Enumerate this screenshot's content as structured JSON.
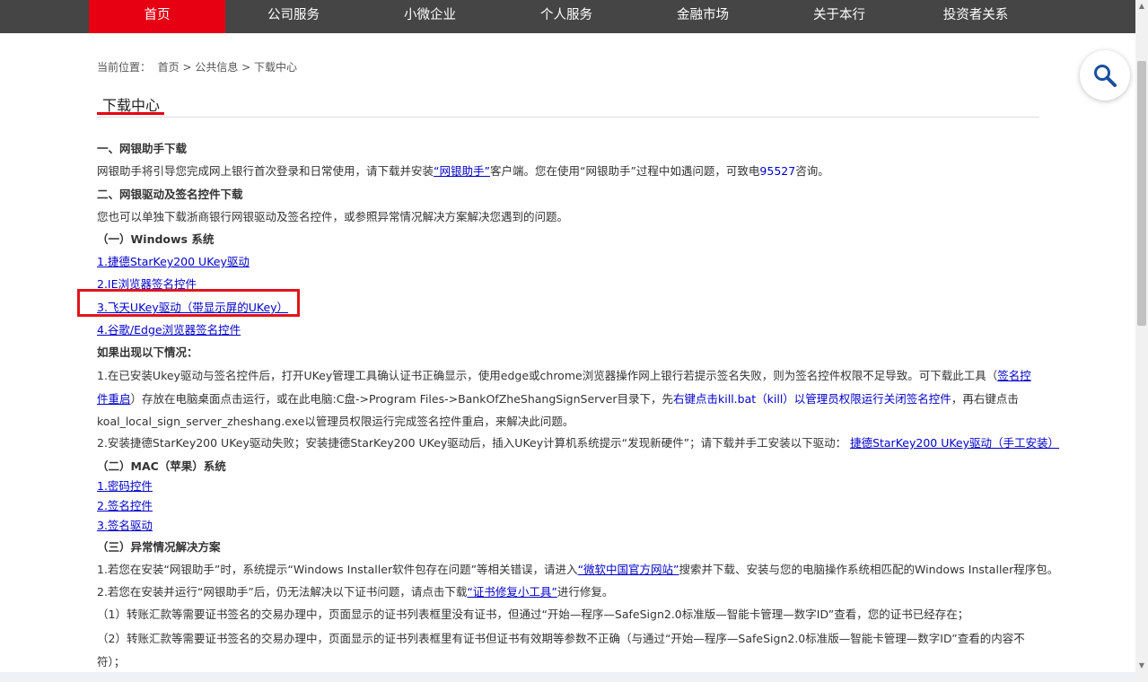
{
  "nav": {
    "items": [
      "首页",
      "公司服务",
      "小微企业",
      "个人服务",
      "金融市场",
      "关于本行",
      "投资者关系"
    ],
    "active_index": 0
  },
  "breadcrumb": {
    "text": "当前位置：  首页 > 公共信息 > 下载中心"
  },
  "page_title": "下载中心",
  "section1": {
    "heading": "一、网银助手下载",
    "text_before": "网银助手将引导您完成网上银行首次登录和日常使用，请下载并安装",
    "link": "“网银助手”",
    "text_mid": "客户端。您在使用“网银助手”过程中如遇问题，可致电",
    "phone": "95527",
    "text_after": "咨询。"
  },
  "section2": {
    "heading": "二、网银驱动及签名控件下载",
    "intro": "您也可以单独下载浙商银行网银驱动及签名控件，或参照异常情况解决方案解决您遇到的问题。",
    "windows": {
      "heading": "（一）Windows 系统",
      "links": [
        "1.捷德StarKey200 UKey驱动",
        "2.IE浏览器签名控件",
        "3.飞天UKey驱动（带显示屏的UKey）",
        "4.谷歌/Edge浏览器签名控件"
      ]
    },
    "cases": {
      "heading": "如果出现以下情况：",
      "case1": {
        "text1": "1.在已安装Ukey驱动与签名控件后，打开UKey管理工具确认证书正确显示，使用edge或chrome浏览器操作网上银行若提示签名失败，则为签名控件权限不足导致。可下载此工具（",
        "link": "签名控件重启",
        "text2": "）存放在电脑桌面点击运行，或在此电脑:C盘->Program Files->BankOfZheShangSignServer目录下，先",
        "red_text": "右键点击kill.bat（kill）以管理员权限运行关闭签名控件",
        "text3": "，再右键点击koal_local_sign_server_zheshang.exe以管理员权限运行完成签名控件重启，来解决此问题。"
      },
      "case2": {
        "text": "2.安装捷德StarKey200 UKey驱动失败；安装捷德StarKey200 UKey驱动后，插入UKey计算机系统提示“发现新硬件”；请下载并手工安装以下驱动：",
        "link": "捷德StarKey200 UKey驱动（手工安装）"
      }
    },
    "mac": {
      "heading": "（二）MAC（苹果）系统",
      "links": [
        "1.密码控件",
        "2.签名控件",
        "3.签名驱动"
      ]
    },
    "exceptions": {
      "heading": "（三）异常情况解决方案",
      "item1": {
        "text1": "1.若您在安装“网银助手”时，系统提示“Windows Installer软件包存在问题”等相关错误，请进入",
        "link": "“微软中国官方网站”",
        "text2": "搜索并下载、安装与您的电脑操作系统相匹配的Windows Installer程序包。"
      },
      "item2": {
        "text1": "2.若您在安装并运行“网银助手”后，仍无法解决以下证书问题，请点击下载",
        "link": "“证书修复小工具”",
        "text2": "进行修复。"
      },
      "sub1": "（1）转账汇款等需要证书签名的交易办理中，页面显示的证书列表框里没有证书，但通过“开始—程序—SafeSign2.0标准版—智能卡管理—数字ID”查看，您的证书已经存在；",
      "sub2": "（2）转账汇款等需要证书签名的交易办理中，页面显示的证书列表框里有证书但证书有效期等参数不正确（与通过“开始—程序—SafeSign2.0标准版—智能卡管理—数字ID”查看的内容不符）；"
    }
  },
  "icons": {
    "search": "search-icon",
    "scroll_up": "scroll-up-arrow",
    "scroll_down": "scroll-down-arrow"
  },
  "colors": {
    "accent": "#e60012",
    "nav_bg": "#454545",
    "link": "#0000cc"
  }
}
